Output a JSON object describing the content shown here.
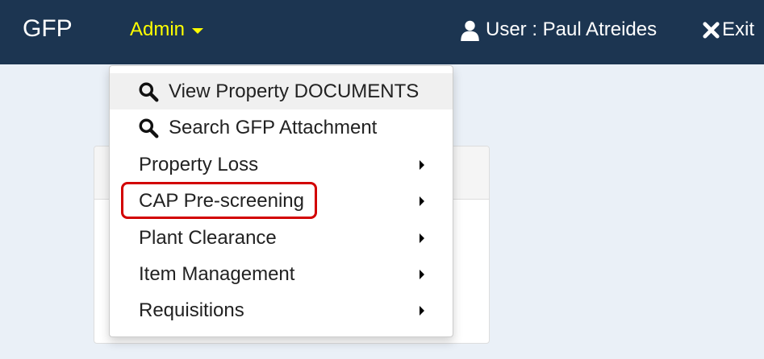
{
  "navbar": {
    "brand": "GFP",
    "admin_label": "Admin",
    "user_label": "User : Paul Atreides",
    "exit_label": "Exit"
  },
  "dropdown": {
    "items": [
      {
        "label": "View Property DOCUMENTS",
        "icon": "search-icon",
        "submenu": false
      },
      {
        "label": "Search GFP Attachment",
        "icon": "search-icon",
        "submenu": false
      },
      {
        "label": "Property Loss",
        "icon": "",
        "submenu": true
      },
      {
        "label": "CAP Pre-screening",
        "icon": "",
        "submenu": true
      },
      {
        "label": "Plant Clearance",
        "icon": "",
        "submenu": true
      },
      {
        "label": "Item Management",
        "icon": "",
        "submenu": true
      },
      {
        "label": "Requisitions",
        "icon": "",
        "submenu": true
      }
    ],
    "hovered_item": "View Property DOCUMENTS",
    "highlighted_item": "CAP Pre-screening"
  },
  "colors": {
    "navbar_bg": "#1c3551",
    "admin_text": "#ffff00",
    "highlight_border": "#d20000",
    "page_bg": "#eaf0f7"
  }
}
